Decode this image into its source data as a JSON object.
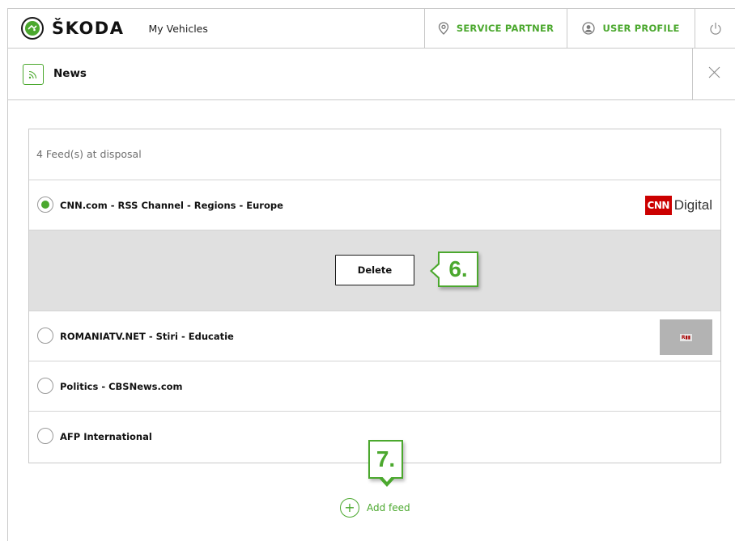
{
  "header": {
    "brand": "ŠKODA",
    "app_title": "My Vehicles",
    "nav": {
      "service_partner": "SERVICE PARTNER",
      "user_profile": "USER PROFILE"
    }
  },
  "news": {
    "title": "News"
  },
  "feeds": {
    "count_text": "4 Feed(s) at disposal",
    "items": [
      {
        "name": "CNN.com - RSS Channel - Regions - Europe",
        "selected": true,
        "logo": "cnn-digital-logo"
      },
      {
        "name": "ROMANIATV.NET - Stiri - Educatie",
        "selected": false,
        "logo": "romaniatv-logo"
      },
      {
        "name": "Politics - CBSNews.com",
        "selected": false
      },
      {
        "name": "AFP International",
        "selected": false
      }
    ],
    "delete_label": "Delete",
    "add_feed_label": "Add feed"
  },
  "logos": {
    "cnn_mark": "CNN",
    "cnn_word": "Digital"
  },
  "callouts": {
    "step6": "6.",
    "step7": "7."
  },
  "colors": {
    "accent": "#4ba82e",
    "cnn_red": "#cc0000",
    "delete_area_bg": "#e0e0e0"
  }
}
